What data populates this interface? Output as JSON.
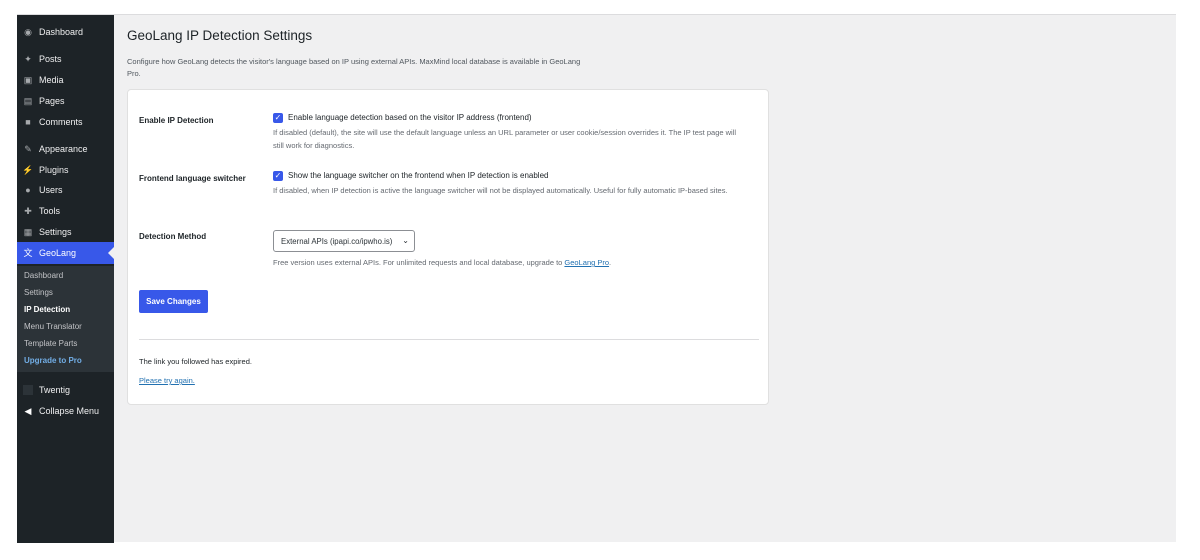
{
  "sidebar": {
    "items": [
      {
        "label": "Dashboard",
        "icon": "dashboard-icon"
      },
      {
        "label": "Posts",
        "icon": "pin-icon"
      },
      {
        "label": "Media",
        "icon": "media-icon"
      },
      {
        "label": "Pages",
        "icon": "pages-icon"
      },
      {
        "label": "Comments",
        "icon": "comment-icon"
      },
      {
        "label": "Appearance",
        "icon": "brush-icon"
      },
      {
        "label": "Plugins",
        "icon": "plugin-icon"
      },
      {
        "label": "Users",
        "icon": "user-icon"
      },
      {
        "label": "Tools",
        "icon": "wrench-icon"
      },
      {
        "label": "Settings",
        "icon": "settings-icon"
      },
      {
        "label": "GeoLang",
        "icon": "translate-icon"
      },
      {
        "label": "Twentig",
        "icon": "twentig-icon"
      },
      {
        "label": "Collapse Menu",
        "icon": "collapse-icon"
      }
    ],
    "submenu": [
      {
        "label": "Dashboard"
      },
      {
        "label": "Settings"
      },
      {
        "label": "IP Detection"
      },
      {
        "label": "Menu Translator"
      },
      {
        "label": "Template Parts"
      },
      {
        "label": "Upgrade to Pro"
      }
    ],
    "accent_color": "#3858e9"
  },
  "page": {
    "title": "GeoLang IP Detection Settings",
    "description": "Configure how GeoLang detects the visitor's language based on IP using external APIs. MaxMind local database is available in GeoLang Pro."
  },
  "settings": {
    "ip_detection": {
      "label": "Enable IP Detection",
      "checkbox_label": "Enable language detection based on the visitor IP address (frontend)",
      "checked": true,
      "help": "If disabled (default), the site will use the default language unless an URL parameter or user cookie/session overrides it. The IP test page will still work for diagnostics."
    },
    "switcher": {
      "label": "Frontend language switcher",
      "checkbox_label": "Show the language switcher on the frontend when IP detection is enabled",
      "checked": true,
      "help": "If disabled, when IP detection is active the language switcher will not be displayed automatically. Useful for fully automatic IP-based sites."
    },
    "method": {
      "label": "Detection Method",
      "selected": "External APIs (ipapi.co/ipwho.is)",
      "help_prefix": "Free version uses external APIs. For unlimited requests and local database, upgrade to",
      "help_link": "GeoLang Pro",
      "help_suffix": "."
    },
    "save_label": "Save Changes"
  },
  "notice": {
    "expired": "The link you followed has expired.",
    "retry": "Please try again."
  }
}
